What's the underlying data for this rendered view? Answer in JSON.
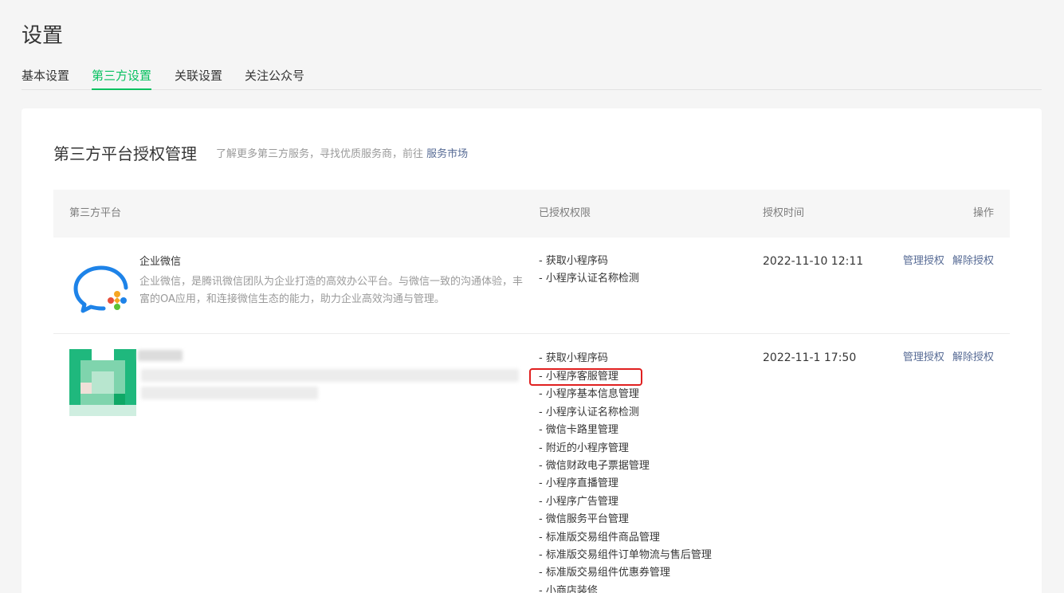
{
  "page": {
    "title": "设置"
  },
  "tabs": [
    {
      "label": "基本设置",
      "active": false
    },
    {
      "label": "第三方设置",
      "active": true
    },
    {
      "label": "关联设置",
      "active": false
    },
    {
      "label": "关注公众号",
      "active": false
    }
  ],
  "section": {
    "title": "第三方平台授权管理",
    "desc_prefix": "了解更多第三方服务，寻找优质服务商，前往 ",
    "market_link": "服务市场"
  },
  "table": {
    "headers": {
      "platform": "第三方平台",
      "permissions": "已授权权限",
      "time": "授权时间",
      "action": "操作"
    },
    "rows": [
      {
        "name": "企业微信",
        "desc": "企业微信，是腾讯微信团队为企业打造的高效办公平台。与微信一致的沟通体验，丰富的OA应用，和连接微信生态的能力，助力企业高效沟通与管理。",
        "icon": "wecom-logo-icon",
        "permissions": [
          "- 获取小程序码",
          "- 小程序认证名称检测"
        ],
        "time": "2022-11-10 12:11",
        "actions": [
          "管理授权",
          "解除授权"
        ]
      },
      {
        "name": "",
        "desc": "",
        "icon": "blurred-logo-icon",
        "permissions": [
          "- 获取小程序码",
          "- 小程序客服管理",
          "- 小程序基本信息管理",
          "- 小程序认证名称检测",
          "- 微信卡路里管理",
          "- 附近的小程序管理",
          "- 微信财政电子票据管理",
          "- 小程序直播管理",
          "- 小程序广告管理",
          "- 微信服务平台管理",
          "- 标准版交易组件商品管理",
          "- 标准版交易组件订单物流与售后管理",
          "- 标准版交易组件优惠券管理",
          "- 小商店装修"
        ],
        "highlighted_permission_index": 1,
        "time": "2022-11-1 17:50",
        "actions": [
          "管理授权",
          "解除授权"
        ]
      }
    ]
  },
  "colors": {
    "accent": "#07c160",
    "link": "#576b95",
    "highlight_box": "#e02020",
    "wecom_blue": "#1e83e8"
  }
}
